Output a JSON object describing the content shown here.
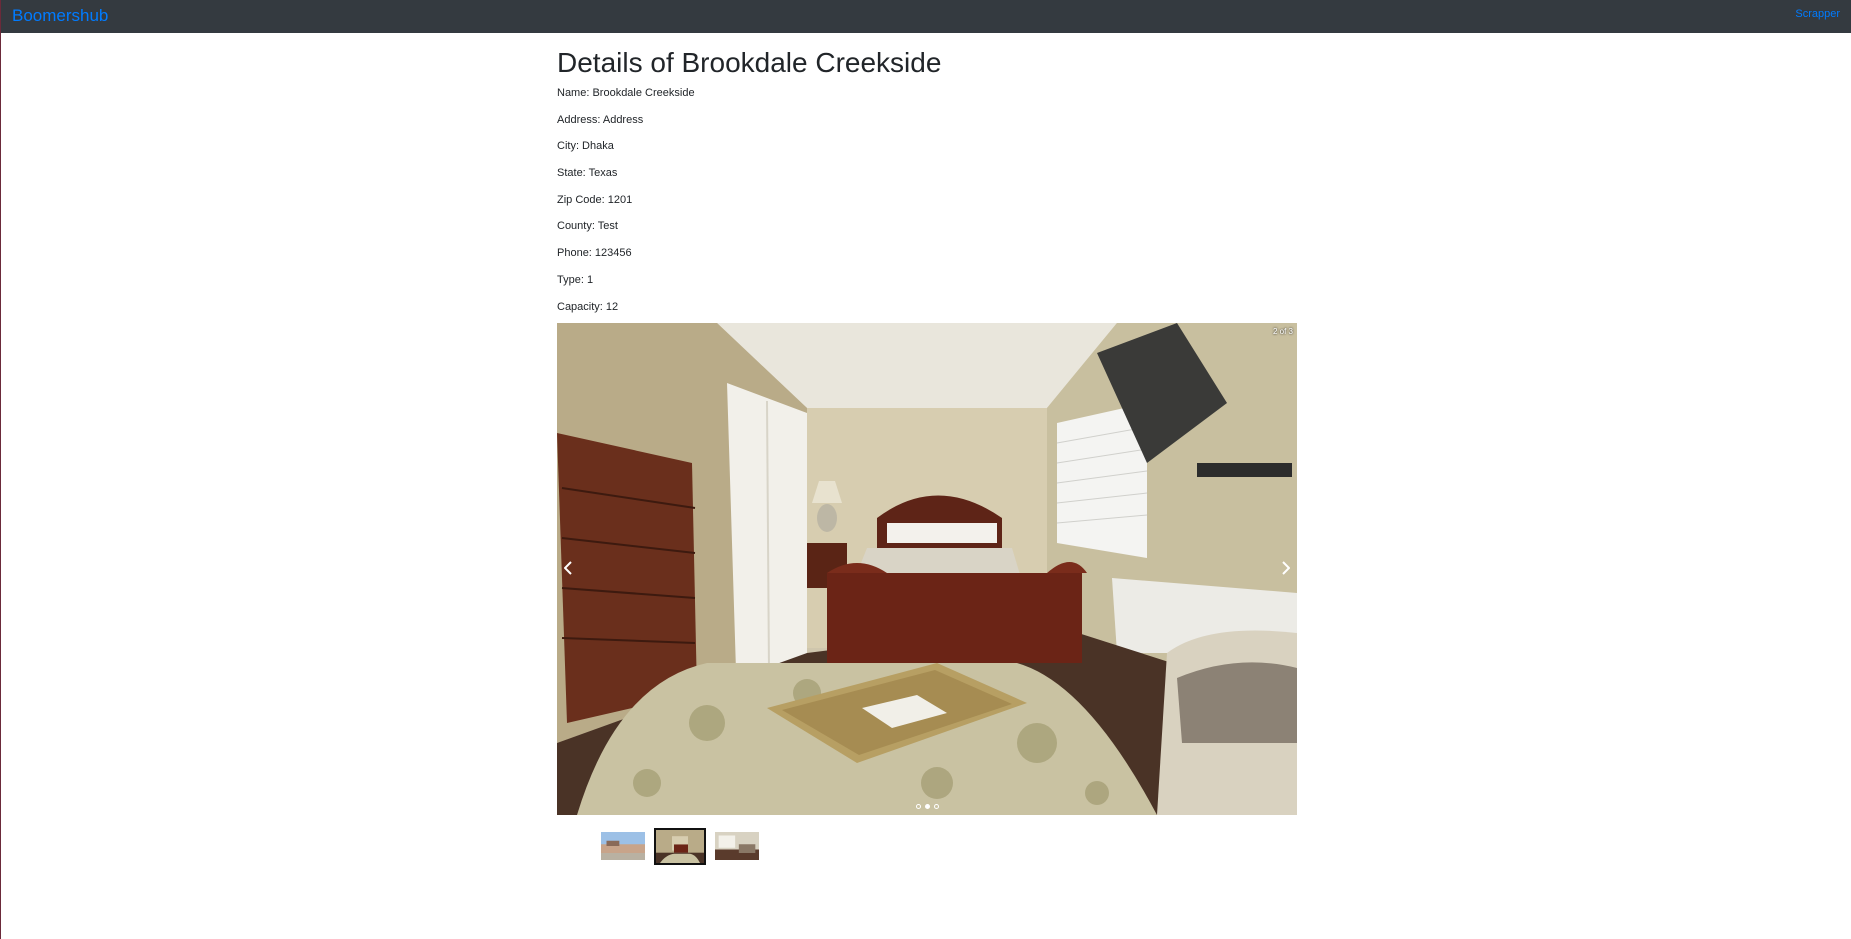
{
  "navbar": {
    "brand": "Boomershub",
    "link": "Scrapper"
  },
  "page": {
    "title": "Details of Brookdale Creekside"
  },
  "details": [
    "Name: Brookdale Creekside",
    "Address: Address",
    "City: Dhaka",
    "State: Texas",
    "Zip Code: 1201",
    "County: Test",
    "Phone: 123456",
    "Type: 1",
    "Capacity: 12"
  ],
  "gallery": {
    "counter": "2 of 3",
    "current_index": 2,
    "total": 3,
    "thumbnails": [
      {
        "name": "thumbnail-exterior",
        "active": false
      },
      {
        "name": "thumbnail-bedroom",
        "active": true
      },
      {
        "name": "thumbnail-living-room",
        "active": false
      }
    ]
  }
}
